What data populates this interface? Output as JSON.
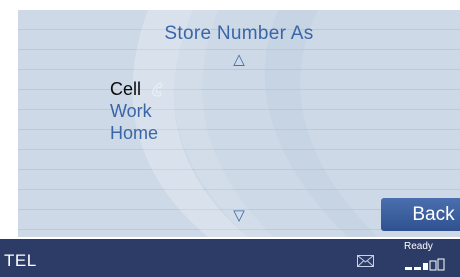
{
  "header": {
    "title": "Store Number As"
  },
  "nav": {
    "up_arrow": "△",
    "down_arrow": "▽"
  },
  "options": [
    {
      "label": "Cell",
      "selected": true
    },
    {
      "label": "Work",
      "selected": false
    },
    {
      "label": "Home",
      "selected": false
    }
  ],
  "back_button": {
    "label": "Back"
  },
  "status_bar": {
    "mode": "TEL",
    "status": "Ready",
    "icons": [
      "envelope-icon",
      "signal-strength-icon"
    ]
  },
  "colors": {
    "panel_bg": "#cdd9e7",
    "accent_text": "#3a66a8",
    "selected_text": "#0a0a0a",
    "status_bar_bg": "#2d3c66",
    "button_bg": "#3b5ea0"
  }
}
